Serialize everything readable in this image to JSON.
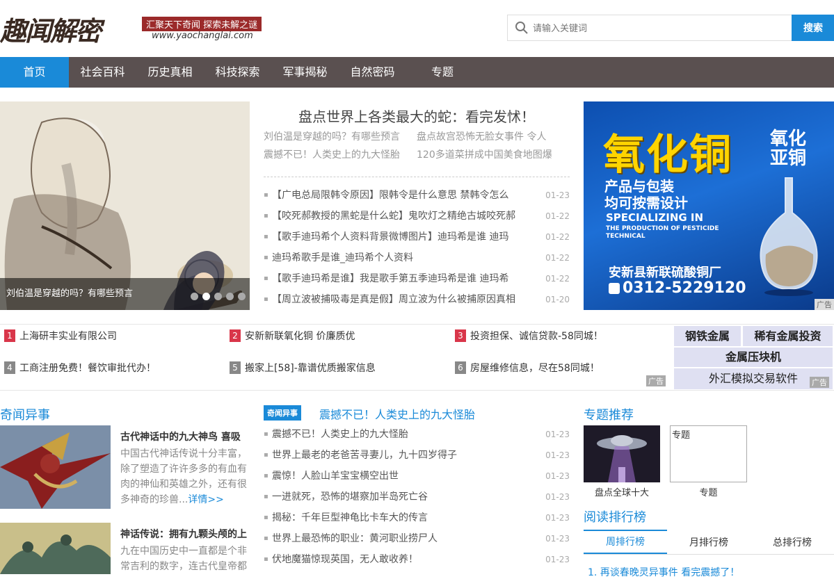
{
  "header": {
    "logo": "趣闻解密",
    "slogan": "汇聚天下奇闻 探索未解之谜",
    "url": "www.yaochanglai.com",
    "search_placeholder": "请输入关键词",
    "search_button": "搜索"
  },
  "nav": [
    "首页",
    "社会百科",
    "历史真相",
    "科技探索",
    "军事揭秘",
    "自然密码",
    "专题"
  ],
  "slider": {
    "caption": "刘伯温是穿越的吗？有哪些预言",
    "dots": 5,
    "active_dot": 1
  },
  "headline": {
    "title": "盘点世界上各类最大的蛇：看完发怵！",
    "links": [
      [
        "刘伯温是穿越的吗？有哪些预言",
        "盘点故宫恐怖无脸女事件 令人"
      ],
      [
        "震撼不已！人类史上的九大怪胎",
        "120多道菜拼成中国美食地图爆"
      ]
    ]
  },
  "news": [
    {
      "title": "【广电总局限韩令原因】限韩令是什么意思 禁韩令怎么",
      "date": "01-23"
    },
    {
      "title": "【咬死郝教授的黑蛇是什么蛇】鬼吹灯之精绝古城咬死郝",
      "date": "01-22"
    },
    {
      "title": "【歌手迪玛希个人资料背景微博图片】迪玛希是谁 迪玛",
      "date": "01-22"
    },
    {
      "title": "迪玛希歌手是谁_迪玛希个人资料",
      "date": "01-22"
    },
    {
      "title": "【歌手迪玛希是谁】我是歌手第五季迪玛希是谁 迪玛希",
      "date": "01-22"
    },
    {
      "title": "【周立波被捕吸毒是真是假】周立波为什么被捕原因真相",
      "date": "01-20"
    }
  ],
  "ad": {
    "title": "氧化铜",
    "side": [
      "氧化",
      "亚铜"
    ],
    "line1": "产品与包装",
    "line2": "均可按需设计",
    "en1": "SPECIALIZING IN",
    "en2": "THE PRODUCTION OF PESTICIDE TECHNICAL",
    "company": "安新县新联硫酸铜厂",
    "phone": "0312-5229120",
    "label": "广告"
  },
  "adlinks": [
    {
      "num": "1",
      "text": "上海研丰实业有限公司"
    },
    {
      "num": "2",
      "text": "安新新联氧化铜 价廉质优"
    },
    {
      "num": "3",
      "text": "投资担保、诚信贷款-58同城！"
    },
    {
      "num": "4",
      "text": "工商注册免费！餐饮审批代办！"
    },
    {
      "num": "5",
      "text": "搬家上[58]-靠谱优质搬家信息"
    },
    {
      "num": "6",
      "text": "房屋维修信息，尽在58同城！"
    }
  ],
  "adlink_tag": "广告",
  "tiles": [
    "钢铁金属",
    "稀有金属投资",
    "金属压块机",
    "外汇模拟交易软件"
  ],
  "tiles_tag": "广告",
  "left_section": {
    "title": "奇闻异事",
    "features": [
      {
        "title": "古代神话中的九大神鸟 喜吸",
        "desc": "中国古代神话传说十分丰富，除了塑造了许许多多的有血有肉的神仙和英雄之外，还有很多神奇的珍兽...",
        "more": "详情>>"
      },
      {
        "title": "神话传说：拥有九颗头颅的上",
        "desc": "九在中国历史中一直都是个非常吉利的数字，连古代皇帝都"
      }
    ]
  },
  "mid_section": {
    "badge": "奇闻异事",
    "headline": "震撼不已！人类史上的九大怪胎",
    "items": [
      {
        "title": "震撼不已！人类史上的九大怪胎",
        "date": "01-23"
      },
      {
        "title": "世界上最老的老爸苦寻妻儿，九十四岁得子",
        "date": "01-23"
      },
      {
        "title": "震惊！人脸山羊宝宝横空出世",
        "date": "01-23"
      },
      {
        "title": "一进就死，恐怖的堪察加半岛死亡谷",
        "date": "01-23"
      },
      {
        "title": "揭秘：千年巨型神龟比卡车大的传言",
        "date": "01-23"
      },
      {
        "title": "世界上最恐怖的职业：黄河职业捞尸人",
        "date": "01-23"
      },
      {
        "title": "伏地魔猫惊现英国，无人敢收养！",
        "date": "01-23"
      }
    ]
  },
  "right_section": {
    "title": "专题推荐",
    "topic1_caption": "盘点全球十大",
    "topic2_box": "专题",
    "topic2_caption": "专题",
    "rank_title": "阅读排行榜",
    "tabs": [
      "周排行榜",
      "月排行榜",
      "总排行榜"
    ],
    "first_item": "1. 再谈春晚灵异事件 看完震撼了！"
  },
  "colors": {
    "accent": "#1a8ad8",
    "nav_bg": "#5a5050",
    "red_num": "#d9364a"
  }
}
